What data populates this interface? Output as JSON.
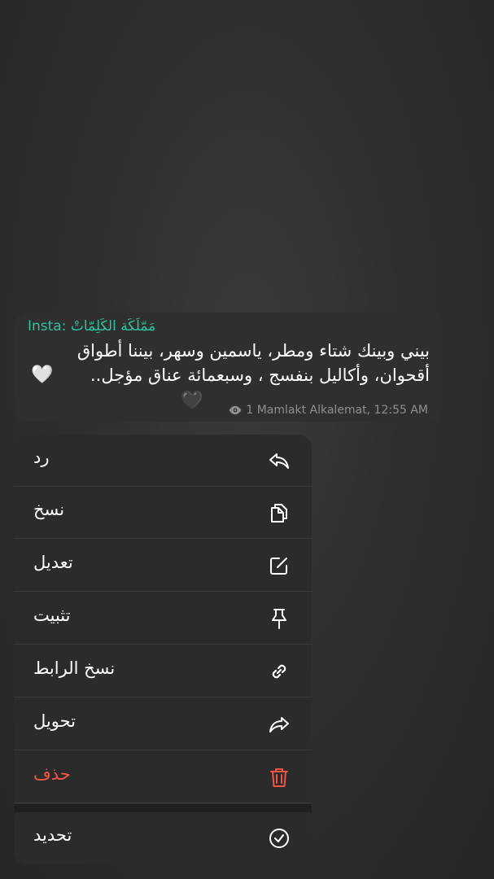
{
  "message": {
    "sender": "Insta: مَمّلَكَة الكَلِمّاتْ",
    "text": "بيني وبينك شتاء ومطر، ياسمين وسهر، بيننا أطواق أقحوان، وأكاليل بنفسج ، وسبعمائة عناق مؤجل..",
    "heart_white": "🤍",
    "heart_black": "🖤",
    "views_icon": "eye-icon",
    "meta": "1 Mamlakt Alkalemat, 12:55 AM"
  },
  "menu": {
    "items": [
      {
        "label": "رد",
        "icon": "reply-icon"
      },
      {
        "label": "نسخ",
        "icon": "copy-icon"
      },
      {
        "label": "تعديل",
        "icon": "edit-icon"
      },
      {
        "label": "تثبيت",
        "icon": "pin-icon"
      },
      {
        "label": "نسخ الرابط",
        "icon": "link-icon"
      },
      {
        "label": "تحويل",
        "icon": "forward-icon"
      },
      {
        "label": "حذف",
        "icon": "trash-icon"
      },
      {
        "label": "تحديد",
        "icon": "select-check-icon"
      }
    ]
  },
  "colors": {
    "accent": "#2ec3a0",
    "destructive": "#f0554a"
  }
}
